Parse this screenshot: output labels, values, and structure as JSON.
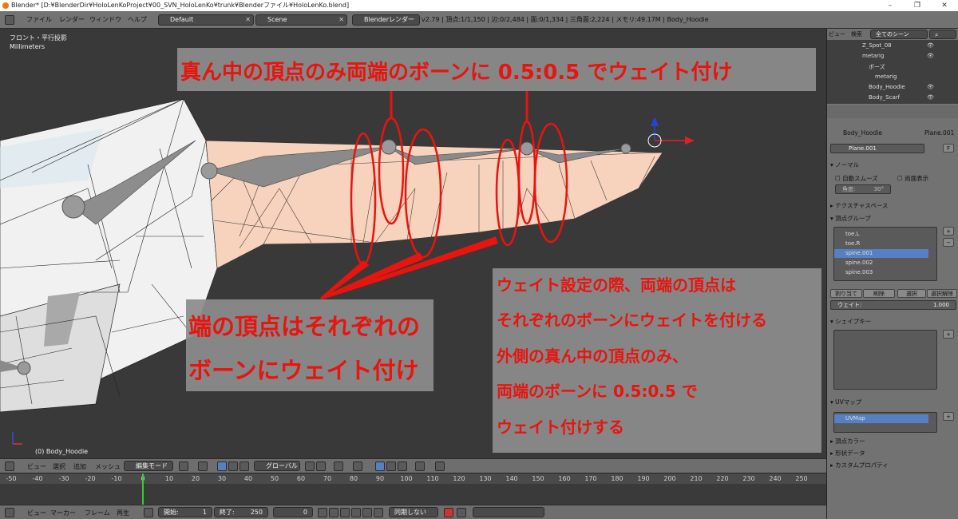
{
  "window": {
    "title": "Blender* [D:¥BlenderDir¥HoloLenKoProject¥00_SVN_HoloLenKo¥trunk¥Blenderファイル¥HoloLenKo.blend]",
    "min": "–",
    "max": "❐",
    "close": "✕"
  },
  "menu": [
    "ファイル",
    "レンダー",
    "ウィンドウ",
    "ヘルプ"
  ],
  "header": {
    "layout": "Default",
    "scene": "Scene",
    "engine": "Blenderレンダー",
    "stats": "v2.79 | 頂点:1/1,150 | 辺:0/2,484 | 面:0/1,334 | 三角面:2,224 | メモリ:49.17M | Body_Hoodie"
  },
  "viewport": {
    "view_name": "フロント・平行投影",
    "units": "Millimeters",
    "object_label": "(0) Body_Hoodie"
  },
  "annotations": {
    "top": "真ん中の頂点のみ両端のボーンに 0.5:0.5 でウェイト付け",
    "left_line1": "端の頂点はそれぞれの",
    "left_line2": "ボーンにウェイト付け",
    "right_lines": [
      "ウェイト設定の際、両端の頂点は",
      "それぞれのボーンにウェイトを付ける",
      "外側の真ん中の頂点のみ、",
      "両端のボーンに 0.5:0.5 で",
      "ウェイト付けする"
    ]
  },
  "view_header": {
    "menus": [
      "ビュー",
      "選択",
      "追加",
      "メッシュ"
    ],
    "mode": "編集モード",
    "orientation": "グローバル"
  },
  "timeline": {
    "ticks": [
      "-50",
      "-40",
      "-30",
      "-20",
      "-10",
      "0",
      "10",
      "20",
      "30",
      "40",
      "50",
      "60",
      "70",
      "80",
      "90",
      "100",
      "110",
      "120",
      "130",
      "140",
      "150",
      "160",
      "170",
      "180",
      "190",
      "200",
      "210",
      "220",
      "230",
      "240",
      "250"
    ],
    "menus": [
      "ビュー",
      "マーカー",
      "フレーム",
      "再生"
    ],
    "start_label": "開始:",
    "start": "1",
    "end_label": "終了:",
    "end": "250",
    "current": "0",
    "sync": "同期しない"
  },
  "outliner": {
    "view": "ビュー",
    "search": "検索",
    "filter": "全てのシーン",
    "items": [
      "Z_Spot_08",
      "metarig",
      "ポーズ",
      "metarig",
      "Body_Hoodie",
      "Body_Scarf"
    ]
  },
  "properties": {
    "breadcrumb_obj": "Body_Hoodie",
    "breadcrumb_mesh": "Plane.001",
    "mesh_name": "Plane.001",
    "fake_user": "F",
    "normals_header": "ノーマル",
    "auto_smooth": "自動スムーズ",
    "double_sided": "両面表示",
    "angle_label": "角度:",
    "angle_value": "30°",
    "texspace_header": "テクスチャスペース",
    "vgroups_header": "頂点グループ",
    "vgroups": [
      "toe.L",
      "toe.R",
      "spine.001",
      "spine.002",
      "spine.003"
    ],
    "selected_vgroup": "spine.001",
    "btn_assign": "割り当て",
    "btn_remove": "削除",
    "btn_select": "選択",
    "btn_deselect": "選択解除",
    "weight_label": "ウェイト:",
    "weight_value": "1.000",
    "shapekeys_header": "シェイプキー",
    "uvmaps_header": "UVマップ",
    "uvmap": "UVMap",
    "vcolors_header": "頂点カラー",
    "geometry_header": "形状データ",
    "custom_header": "カスタムプロパティ"
  },
  "colors": {
    "accent_select": "#5680c2",
    "annotation_red": "#e8140e",
    "frame_cursor": "#33cc33"
  }
}
